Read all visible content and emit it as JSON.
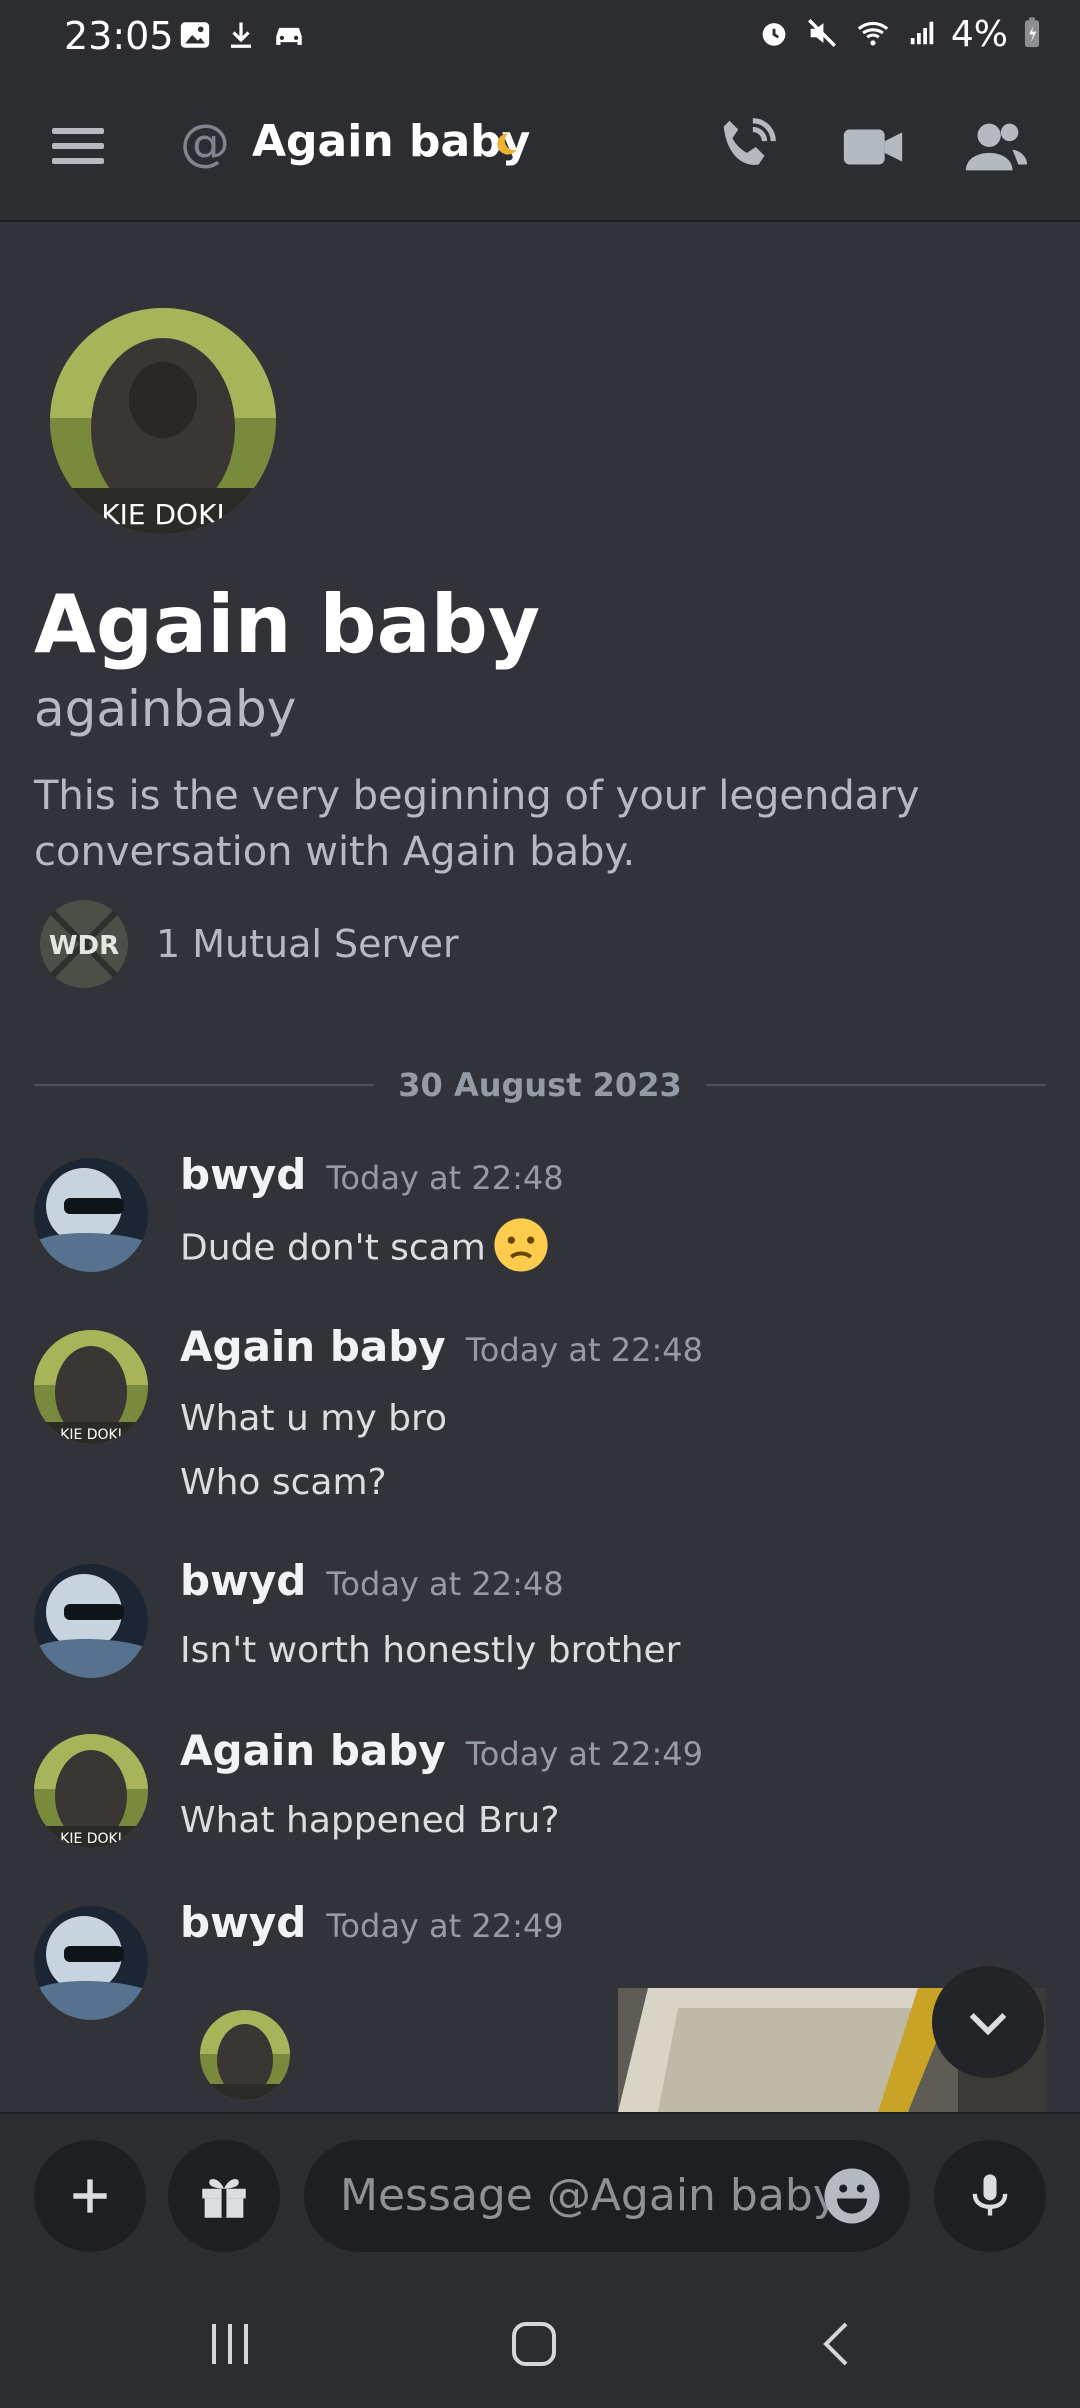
{
  "status_bar": {
    "time": "23:05",
    "battery_percent": "4%",
    "left_icons": [
      "image-icon",
      "download-icon",
      "car-icon"
    ],
    "right_icons": [
      "alarm-icon",
      "mute-icon",
      "wifi-icon",
      "signal-icon",
      "battery-charging-icon"
    ]
  },
  "header": {
    "channel_symbol": "@",
    "title": "Again baby",
    "status": "idle",
    "actions": [
      "voice-call-icon",
      "video-call-icon",
      "members-icon"
    ]
  },
  "intro": {
    "avatar_caption": "KIE DOKI",
    "display_name": "Again baby",
    "username": "againbaby",
    "description": "This is the very beginning of your legendary conversation with Again baby.",
    "mutual_server_badge": "WDR",
    "mutual_servers": "1 Mutual Server"
  },
  "divider": {
    "date": "30 August 2023"
  },
  "messages": [
    {
      "author": "bwyd",
      "timestamp": "Today at 22:48",
      "lines": [
        "Dude don't scam"
      ],
      "emoji": "frowning-face"
    },
    {
      "author": "Again baby",
      "timestamp": "Today at 22:48",
      "lines": [
        "What u my bro",
        "Who scam?"
      ],
      "avatar_caption": "KIE DOKI"
    },
    {
      "author": "bwyd",
      "timestamp": "Today at 22:48",
      "lines": [
        "Isn't worth honestly brother"
      ]
    },
    {
      "author": "Again baby",
      "timestamp": "Today at 22:49",
      "lines": [
        "What happened Bru?"
      ],
      "avatar_caption": "KIE DOKI"
    },
    {
      "author": "bwyd",
      "timestamp": "Today at 22:49",
      "lines": []
    }
  ],
  "composer": {
    "placeholder": "Message @Again baby"
  },
  "colors": {
    "background": "#313338",
    "header": "#2b2d31",
    "input": "#1e1f22",
    "idle": "#f0b232"
  }
}
